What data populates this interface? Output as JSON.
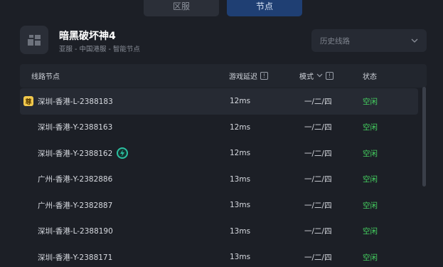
{
  "tabs": {
    "region": "区服",
    "node": "节点"
  },
  "game": {
    "title": "暗黑破坏神4",
    "subtitle": "亚服 - 中国港服 - 智能节点"
  },
  "history_select": {
    "label": "历史线路"
  },
  "table": {
    "headers": {
      "node": "线路节点",
      "latency": "游戏延迟",
      "mode": "模式",
      "status": "状态"
    },
    "rows": [
      {
        "node": "深圳-香港-L-2388183",
        "latency": "12ms",
        "mode": "一/二/四",
        "status": "空闲"
      },
      {
        "node": "深圳-香港-Y-2388163",
        "latency": "12ms",
        "mode": "一/二/四",
        "status": "空闲"
      },
      {
        "node": "深圳-香港-Y-2388162",
        "latency": "12ms",
        "mode": "一/二/四",
        "status": "空闲"
      },
      {
        "node": "广州-香港-Y-2382886",
        "latency": "13ms",
        "mode": "一/二/四",
        "status": "空闲"
      },
      {
        "node": "广州-香港-Y-2382887",
        "latency": "13ms",
        "mode": "一/二/四",
        "status": "空闲"
      },
      {
        "node": "深圳-香港-L-2388190",
        "latency": "13ms",
        "mode": "一/二/四",
        "status": "空闲"
      },
      {
        "node": "深圳-香港-Y-2388171",
        "latency": "13ms",
        "mode": "一/二/四",
        "status": "空闲"
      }
    ],
    "vip_badge": "尊"
  },
  "colors": {
    "background": "#1c1f26",
    "active_tab": "#1f3f73",
    "status_idle": "#45d160",
    "vip": "#f2c94c",
    "bolt": "#2bbfa0"
  },
  "icons": {
    "game": "game-logo-icon",
    "dropdown": "chevron-down-icon",
    "help": "question-icon",
    "sort": "chevron-down-icon",
    "boost": "lightning-bolt-icon"
  }
}
